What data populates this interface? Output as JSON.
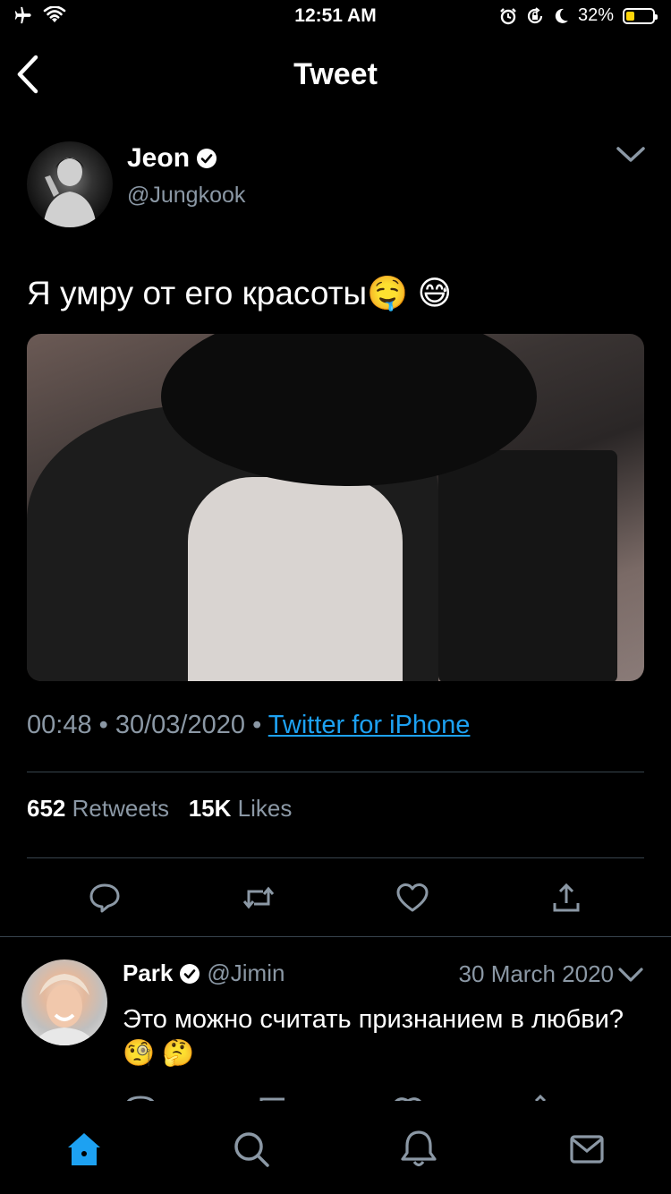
{
  "status_bar": {
    "time": "12:51 AM",
    "battery": "32%",
    "battery_level": 0.32,
    "left_icons": [
      "airplane-icon",
      "wifi-icon"
    ],
    "right_icons": [
      "alarm-icon",
      "rotation-lock-icon",
      "moon-icon"
    ]
  },
  "header": {
    "title": "Tweet",
    "back_icon": "chevron-left-icon"
  },
  "tweet": {
    "author_name": "Jeon",
    "author_handle": "@Jungkook",
    "text": "Я умру от его красоты🤤 😅",
    "time": "00:48",
    "date": "30/03/2020",
    "source": "Twitter for iPhone",
    "retweets": "652",
    "retweets_label": "Retweets",
    "likes": "15K",
    "likes_label": "Likes",
    "actions": [
      "reply-icon",
      "retweet-icon",
      "like-icon",
      "share-icon"
    ]
  },
  "reply": {
    "author_name": "Park",
    "author_handle": "@Jimin",
    "date": "30 March 2020",
    "text": "Это можно считать признанием в любви?🧐 🤔"
  },
  "tabbar": {
    "items": [
      "home-icon",
      "search-icon",
      "notifications-icon",
      "messages-icon"
    ],
    "active_color": "#1da1f2"
  },
  "colors": {
    "background": "#000000",
    "secondary_text": "#8b98a5",
    "link": "#1da1f2",
    "divider": "#38444d"
  }
}
